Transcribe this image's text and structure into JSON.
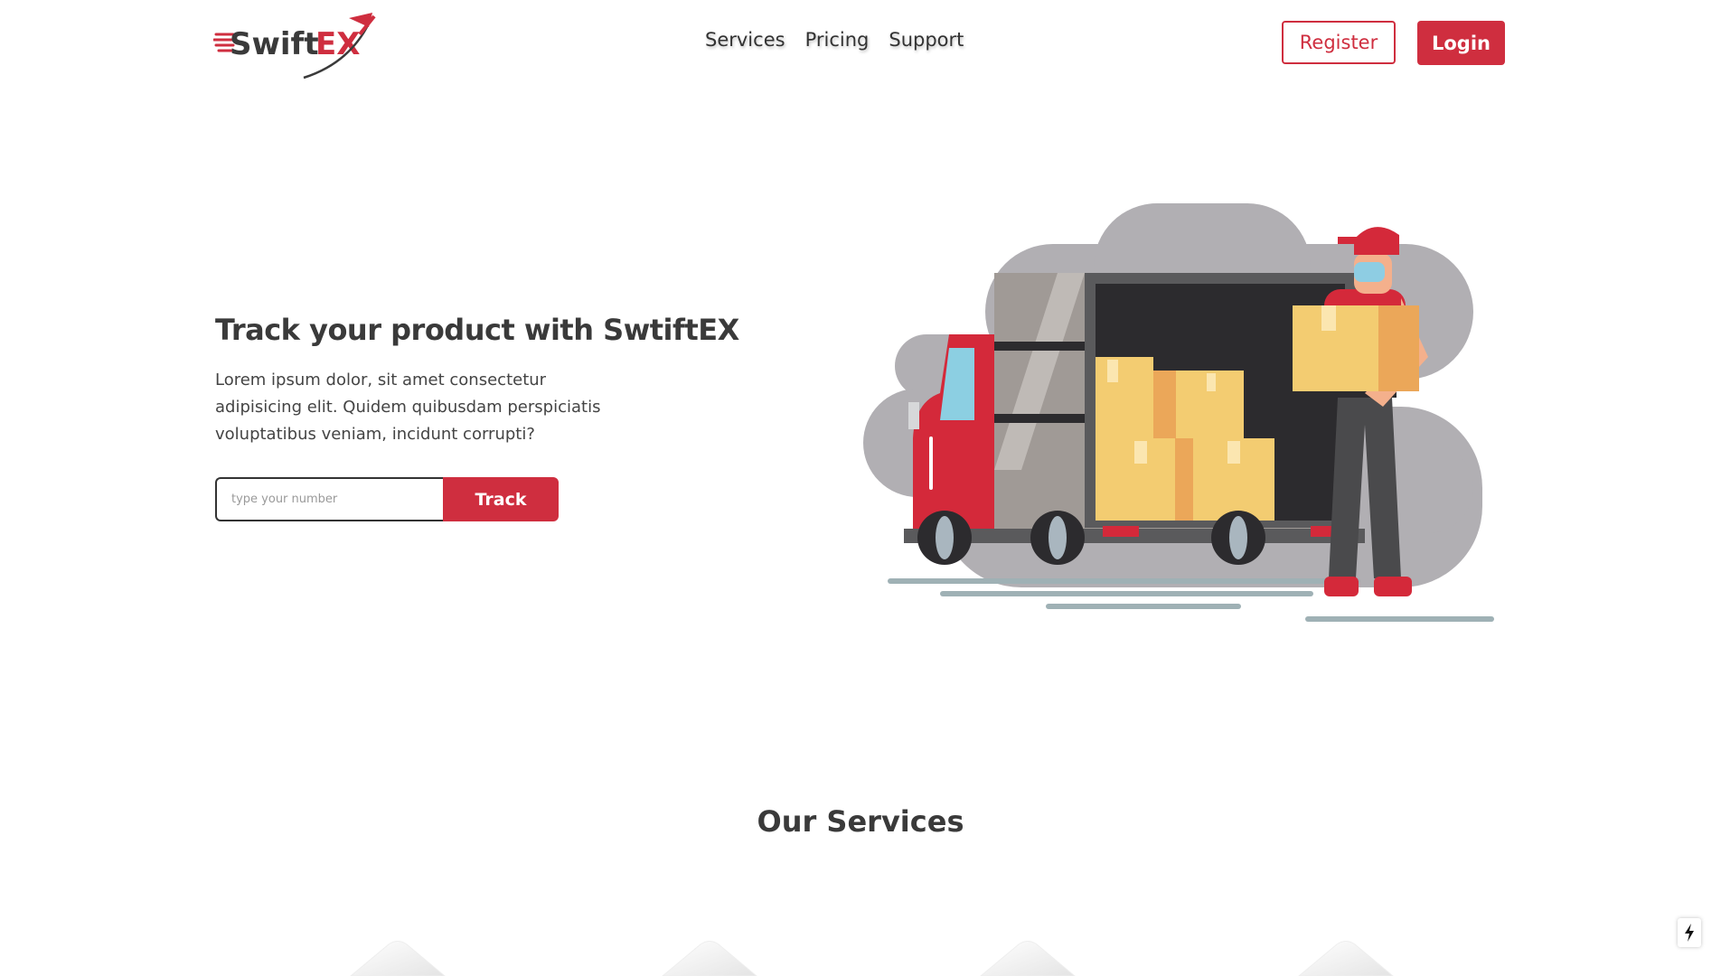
{
  "brand": {
    "logo_text_1": "Swift",
    "logo_text_2": "EX",
    "accent_color": "#cf2e3f"
  },
  "nav": {
    "links": [
      "Services",
      "Pricing",
      "Support"
    ],
    "register_label": "Register",
    "login_label": "Login"
  },
  "hero": {
    "title": "Track your product with SwtiftEX",
    "description": "Lorem ipsum dolor, sit amet consectetur adipisicing elit. Quidem quibusdam perspiciatis voluptatibus veniam, incidunt corrupti?",
    "track_placeholder": "type your number",
    "track_value": "",
    "track_button": "Track",
    "illustration": "delivery-truck-courier-illustration"
  },
  "services": {
    "title": "Our Services"
  },
  "icons": {
    "quick_action": "lightning-bolt-icon"
  }
}
